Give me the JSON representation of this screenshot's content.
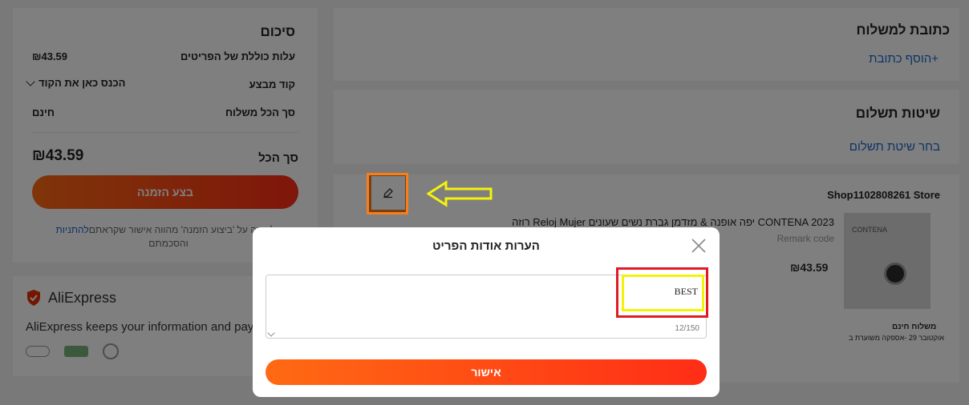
{
  "summary": {
    "title": "סיכום",
    "items_total_label": "עלות כוללת של הפריטים",
    "items_total_value": "₪43.59",
    "promo_label": "קוד מבצע",
    "promo_placeholder": "הכנס כאן את הקוד",
    "shipping_label": "סך הכל משלוח",
    "shipping_value": "חינם",
    "total_label": "סך הכל",
    "total_value": "₪43.59",
    "place_order_label": "בצע הזמנה",
    "terms_text_1": "בלחיצה על 'ביצוע הזמנה' מהווה אישור שקראתם",
    "terms_link": "להתניות",
    "terms_text_2": "והסכמתם"
  },
  "trust": {
    "brand": "AliExpress",
    "text": "AliExpress keeps your information and payment safe"
  },
  "shipping_address": {
    "title": "כתובת למשלוח",
    "add_label": "+הוסף כתובת"
  },
  "payment": {
    "title": "שיטות תשלום",
    "choose_label": "בחר שיטת תשלום"
  },
  "store": {
    "name": "Shop1102808261 Store",
    "product_title": "CONTENA 2023 יפה אופנה & מזדמן גברת נשים שעונים Reloj Mujer רוזה",
    "remark": "Remark code",
    "price": "₪43.59",
    "shipping": "משלוח חינם",
    "delivery": "אוקטובר 29 -אספקה משוערת ב",
    "image_brand": "CONTENA"
  },
  "modal": {
    "title": "הערות אודות הפריט",
    "note_value": "BEST",
    "counter": "12/150",
    "confirm_label": "אישור"
  },
  "colors": {
    "accent": "#ff4e14",
    "link": "#1a66c9",
    "highlight_yellow": "#f5f20a",
    "highlight_red": "#e01b24",
    "highlight_orange": "#f57f1f"
  }
}
